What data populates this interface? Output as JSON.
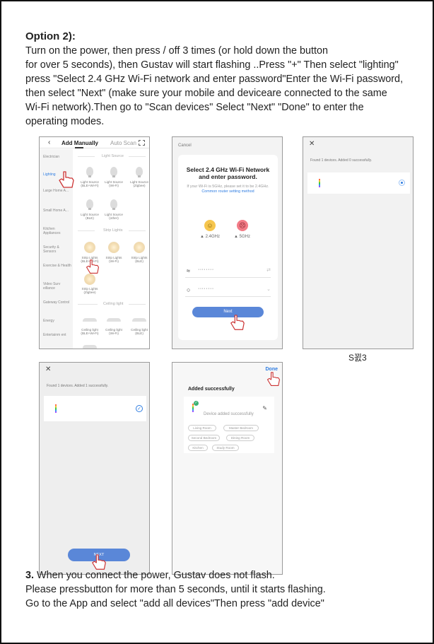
{
  "intro": {
    "heading": "Option 2):",
    "line1": "Turn on the power, then press / off 3 times (or hold down the button",
    "line2": "for over 5 seconds), then Gustav will start flashing ..Press \"+\" Then select \"lighting\"",
    "line3": "press \"Select 2.4 GHz Wi-Fi network and enter password\"Enter the Wi-Fi password,",
    "line4": "then select \"Next\" (make sure your mobile and deviceare connected to the same",
    "line5": "Wi-Fi network).Then go to \"Scan devices\" Select \"Next\" \"Done\" to enter the",
    "line6": "operating modes."
  },
  "phone1": {
    "tab_manual": "Add Manually",
    "tab_auto": "Auto Scan",
    "sidebar": [
      "Electrician",
      "Lighting",
      "Large Home A...",
      "Small Home A...",
      "Kitchen Appliances",
      "Security & Sensors",
      "Exercise & Health",
      "Video Surv eillance",
      "Gateway Control",
      "Energy",
      "Entertainm ent"
    ],
    "section_light": "Light Source",
    "section_strip": "Strip Lights",
    "section_ceiling": "Ceiling light",
    "light_sources": [
      "Light Source (BLE+Wi-Fi)",
      "Light Source (Wi-Fi)",
      "Light Source (Zigbee)",
      "Light Source (BLE)",
      "Light Source (other)"
    ],
    "strip_lights": [
      "Strip Lights (BLE+Wi-Fi)",
      "Strip Lights (Wi-Fi)",
      "Strip Lights (BLE)",
      "Strip Lights (Zigbee)"
    ],
    "ceiling_lights": [
      "Ceiling light (BLE+Wi-Fi)",
      "Ceiling light (Wi-Fi)",
      "Ceiling light (BLE)"
    ]
  },
  "phone2": {
    "cancel": "Cancel",
    "title": "Select 2.4 GHz Wi-Fi Network and enter password.",
    "sub": "If your Wi-Fi is 5GHz, please set it to be 2.4GHz.",
    "sub_link": "Common router setting method",
    "freq_good": "2.4GHz",
    "freq_bad": "5GHz",
    "wifi_value": "········",
    "password_value": "········",
    "next": "Next"
  },
  "phone3": {
    "found": "Found 1 devices. Added 0 successfully."
  },
  "caption": "S꾌3",
  "phone4": {
    "found": "Found 1 devices. Added 1 successfully.",
    "next": "NEXT"
  },
  "phone5": {
    "done": "Done",
    "added": "Added successfully",
    "device_added": "Device added successfully",
    "rooms": [
      "Living Room",
      "Master Bedroom",
      "Second Bedroom",
      "Dining Room",
      "Kitchen",
      "Study Room"
    ]
  },
  "step3": {
    "number": "3.",
    "line1": " When you connect the power, Gustav does not flash.",
    "line2": "Please pressbutton for more than 5 seconds, until it starts flashing.",
    "line3": "Go to the App and select \"add all devices\"Then press \"add device\""
  }
}
